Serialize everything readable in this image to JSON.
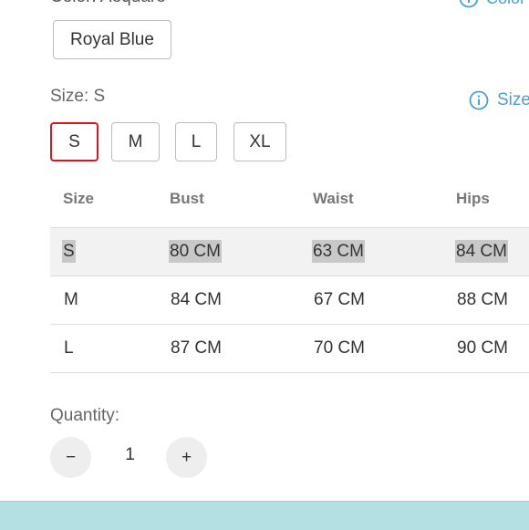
{
  "color": {
    "label": "Color: Aequare",
    "guide_label": "Color",
    "selected_option": "Royal Blue"
  },
  "size": {
    "label": "Size: S",
    "guide_label": "Size",
    "options": [
      "S",
      "M",
      "L",
      "XL"
    ],
    "selected": "S"
  },
  "size_table": {
    "headers": [
      "Size",
      "Bust",
      "Waist",
      "Hips"
    ],
    "rows": [
      [
        "S",
        "80 CM",
        "63 CM",
        "84 CM"
      ],
      [
        "M",
        "84 CM",
        "67 CM",
        "88 CM"
      ],
      [
        "L",
        "87 CM",
        "70 CM",
        "90 CM"
      ]
    ]
  },
  "quantity": {
    "label": "Quantity:",
    "value": "1",
    "decrement": "−",
    "increment": "+"
  },
  "colors": {
    "selected_border": "#e0121b",
    "link": "#4a9fd5",
    "bottom_bar": "#b4e0e4"
  }
}
